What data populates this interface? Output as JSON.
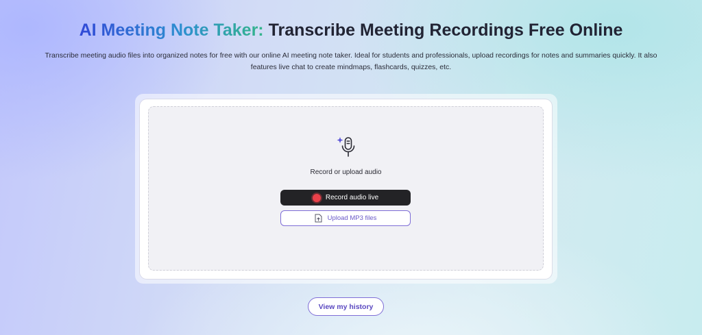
{
  "header": {
    "title_accent": "AI Meeting Note Taker:",
    "title_rest": "Transcribe Meeting Recordings Free Online",
    "description_line1": "Transcribe meeting audio files into organized notes for free with our online AI meeting note taker. Ideal for students and professionals, upload recordings for notes and summaries quickly. It also",
    "description_line2": "features live chat to create mindmaps, flashcards, quizzes, etc."
  },
  "upload": {
    "icon": "microphone-sparkle-icon",
    "prompt": "Record or upload audio",
    "record_label": "Record audio live",
    "upload_label": "Upload MP3 files"
  },
  "footer": {
    "history_label": "View my history"
  },
  "colors": {
    "accent_start": "#3149d6",
    "accent_end": "#34b58a",
    "record_button": "#232326",
    "record_dot": "#e9414a",
    "outline_purple": "#7e6dd6"
  }
}
